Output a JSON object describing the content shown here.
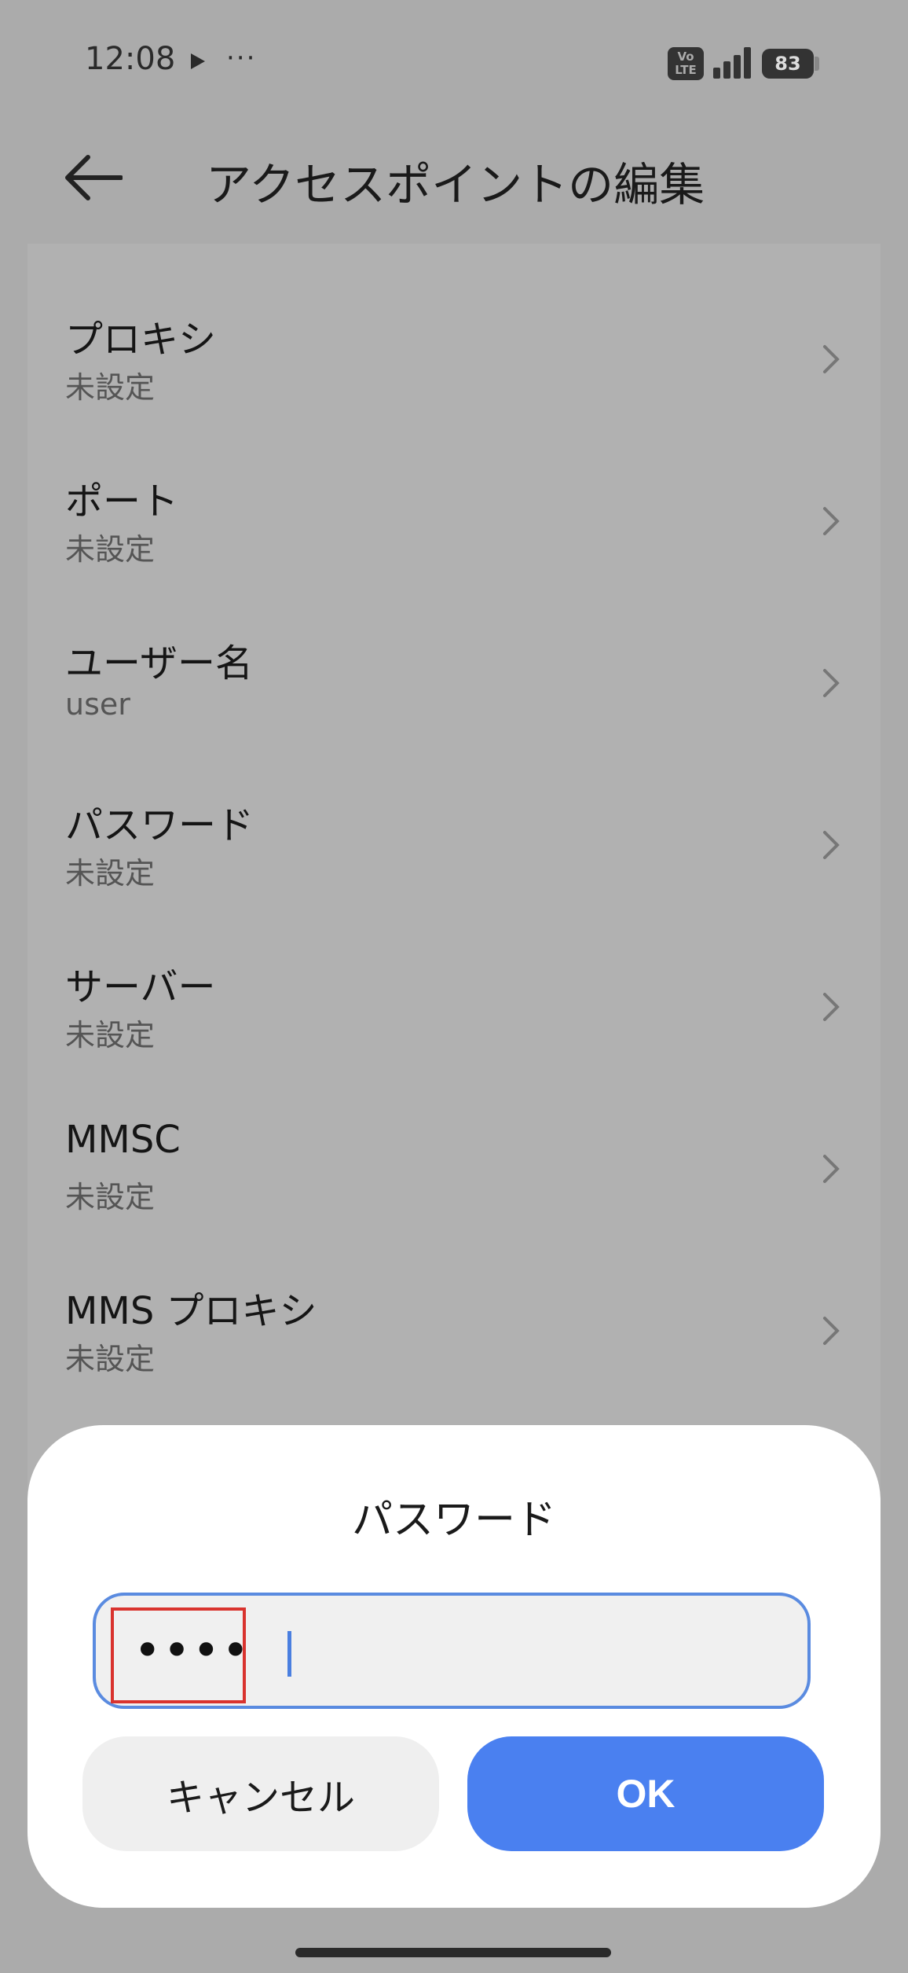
{
  "status_bar": {
    "time": "12:08",
    "volte_line1": "Vo",
    "volte_line2": "LTE",
    "battery": "83",
    "icons": [
      "play-icon",
      "more-icon",
      "volte-icon",
      "signal-icon",
      "battery-icon"
    ]
  },
  "header": {
    "title": "アクセスポイントの編集"
  },
  "settings": [
    {
      "title": "プロキシ",
      "value": "未設定"
    },
    {
      "title": "ポート",
      "value": "未設定"
    },
    {
      "title": "ユーザー名",
      "value": "user"
    },
    {
      "title": "パスワード",
      "value": "未設定"
    },
    {
      "title": "サーバー",
      "value": "未設定"
    },
    {
      "title": "MMSC",
      "value": "未設定"
    },
    {
      "title": "MMS プロキシ",
      "value": "未設定"
    }
  ],
  "dialog": {
    "title": "パスワード",
    "input_value": "••••",
    "cancel_label": "キャンセル",
    "ok_label": "OK"
  },
  "colors": {
    "accent": "#4a80f0",
    "input_border": "#5a8be0",
    "highlight": "#d9332e"
  }
}
